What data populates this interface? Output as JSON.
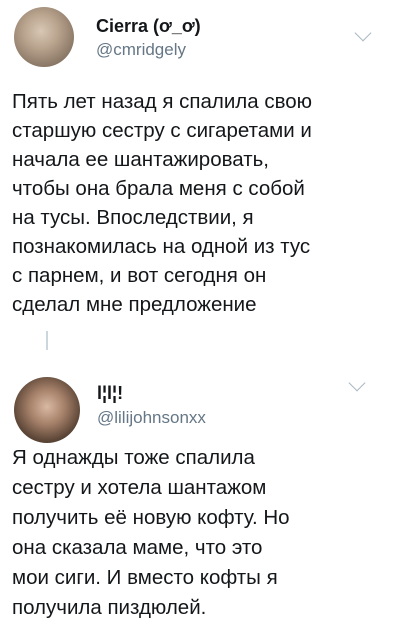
{
  "tweets": [
    {
      "name": "Cierra (ơ_ơ)",
      "handle": "@cmridgely",
      "avatar_icon": "user-photo-avatar",
      "menu_icon": "chevron-down-icon",
      "lines": [
        "Пять лет назад я спалила свою",
        "старшую сестру с сигаретами и",
        "начала ее шантажировать,",
        "чтобы она брала меня с собой",
        "на тусы. Впоследствии, я",
        "познакомилась на одной из тус",
        "с парнем, и вот сегодня он",
        "сделал мне предложение"
      ]
    },
    {
      "name": "l¦l¦!",
      "handle": "@lilijohnsonxx",
      "avatar_icon": "user-photo-avatar",
      "menu_icon": "chevron-down-icon",
      "lines": [
        "Я однажды тоже спалила",
        "сестру и хотела шантажом",
        "получить её новую кофту. Но",
        "она сказала маме, что это",
        "мои сиги. И вместо кофты я",
        "получила пиздюлей."
      ]
    }
  ],
  "colors": {
    "text": "#14171a",
    "handle": "#657786",
    "thread_line": "#ccd6dd"
  }
}
